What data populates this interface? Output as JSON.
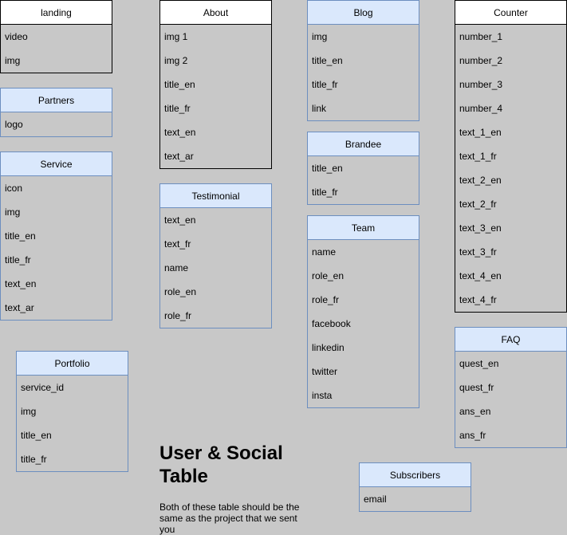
{
  "entities": [
    {
      "key": "landing",
      "title": "landing",
      "style": "white",
      "fields": [
        "video",
        "img"
      ]
    },
    {
      "key": "partners",
      "title": "Partners",
      "style": "blue",
      "fields": [
        "logo"
      ]
    },
    {
      "key": "service",
      "title": "Service",
      "style": "blue",
      "fields": [
        "icon",
        "img",
        "title_en",
        "title_fr",
        "text_en",
        "text_ar"
      ]
    },
    {
      "key": "portfolio",
      "title": "Portfolio",
      "style": "blue",
      "fields": [
        "service_id",
        "img",
        "title_en",
        "title_fr"
      ]
    },
    {
      "key": "about",
      "title": "About",
      "style": "white",
      "fields": [
        "img 1",
        "img 2",
        "title_en",
        "title_fr",
        "text_en",
        "text_ar"
      ]
    },
    {
      "key": "testimonial",
      "title": "Testimonial",
      "style": "blue",
      "fields": [
        "text_en",
        "text_fr",
        "name",
        "role_en",
        "role_fr"
      ]
    },
    {
      "key": "blog",
      "title": "Blog",
      "style": "blue",
      "fields": [
        "img",
        "title_en",
        "title_fr",
        "link"
      ]
    },
    {
      "key": "brandee",
      "title": "Brandee",
      "style": "blue",
      "fields": [
        "title_en",
        "title_fr"
      ]
    },
    {
      "key": "team",
      "title": "Team",
      "style": "blue",
      "fields": [
        "name",
        "role_en",
        "role_fr",
        "facebook",
        "linkedin",
        "twitter",
        "insta"
      ]
    },
    {
      "key": "counter",
      "title": "Counter",
      "style": "white",
      "fields": [
        "number_1",
        "number_2",
        "number_3",
        "number_4",
        "text_1_en",
        "text_1_fr",
        "text_2_en",
        "text_2_fr",
        "text_3_en",
        "text_3_fr",
        "text_4_en",
        "text_4_fr"
      ]
    },
    {
      "key": "faq",
      "title": "FAQ",
      "style": "blue",
      "fields": [
        "quest_en",
        "quest_fr",
        "ans_en",
        "ans_fr"
      ]
    },
    {
      "key": "subscribers",
      "title": "Subscribers",
      "style": "blue",
      "fields": [
        "email"
      ]
    }
  ],
  "note": {
    "title": "User & Social Table",
    "body": "Both of these table should be the same as the project that we sent you"
  }
}
